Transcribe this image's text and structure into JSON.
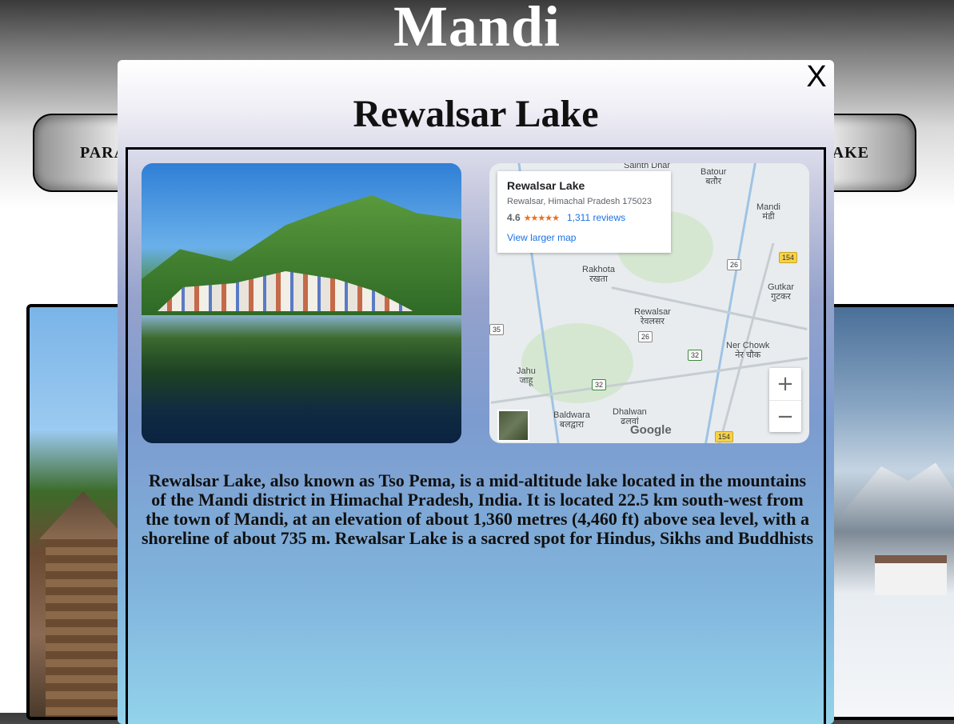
{
  "site": {
    "title": "Mandi"
  },
  "nav": {
    "left_label": "PARA",
    "right_label": "AKE"
  },
  "modal": {
    "close_label": "X",
    "title": "Rewalsar Lake",
    "description": "Rewalsar Lake, also known as Tso Pema, is a mid-altitude lake located in the mountains of the Mandi district in Himachal Pradesh, India. It is located 22.5 km south-west from the town of Mandi, at an elevation of about 1,360 metres (4,460 ft) above sea level, with a shoreline of about 735 m. Rewalsar Lake is a sacred spot for Hindus, Sikhs and Buddhists"
  },
  "map": {
    "place_name": "Rewalsar Lake",
    "address": "Rewalsar, Himachal Pradesh 175023",
    "rating": "4.6",
    "stars": "★★★★★",
    "reviews": "1,311 reviews",
    "larger_map": "View larger map",
    "zoom_in": "+",
    "zoom_out": "−",
    "google": "Google",
    "labels": {
      "batour": "Batour\nबतौर",
      "mandi": "Mandi\nमंडी",
      "rakhota": "Rakhota\nरखता",
      "gutkar": "Gutkar\nगुटकर",
      "rewalsar": "Rewalsar\nरेवलसर",
      "ner_chowk": "Ner Chowk\nनेर चौक",
      "jahu": "Jahu\nजाहू",
      "baldwara": "Baldwara\nबलद्वारा",
      "dhalwan": "Dhalwan\nढलवां",
      "top_cut": "Sainth Dhar"
    },
    "road_badges": {
      "r26a": "26",
      "r154a": "154",
      "r35": "35",
      "r26b": "26",
      "r32a": "32",
      "r32b": "32",
      "r154b": "154"
    }
  },
  "colors": {
    "modal_top": "#ffffff",
    "modal_bottom": "#93d3eb",
    "link": "#1a73e8",
    "star": "#e7711b"
  }
}
